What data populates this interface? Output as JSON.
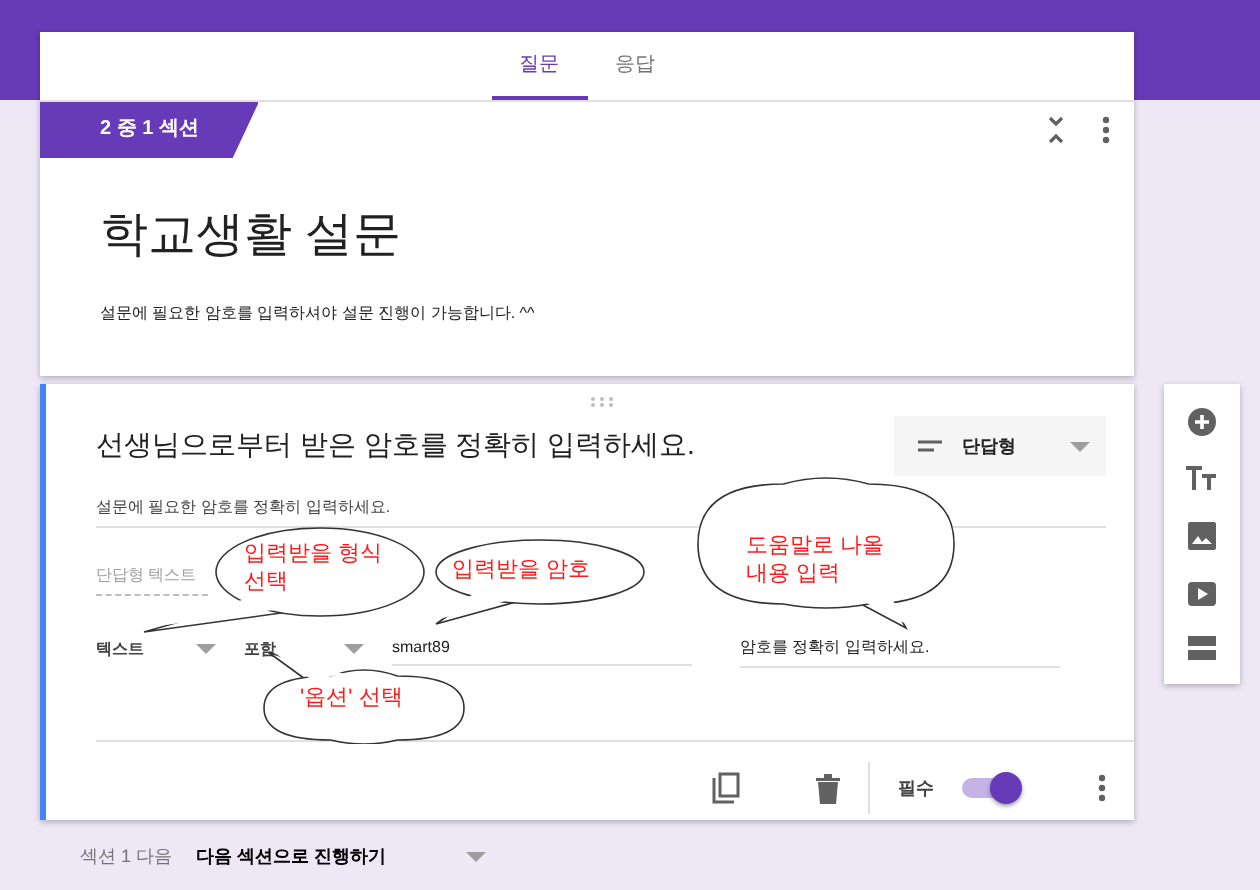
{
  "tabs": [
    {
      "label": "질문",
      "selected": true
    },
    {
      "label": "응답",
      "selected": false
    }
  ],
  "section": {
    "badge": "2 중 1 섹션",
    "title": "학교생활 설문",
    "description": "설문에 필요한 암호를 입력하셔야 설문 진행이 가능합니다. ^^"
  },
  "question": {
    "title": "선생님으로부터 받은 암호를 정확히 입력하세요.",
    "type": "단답형",
    "description": "설문에 필요한 암호를 정확히 입력하세요.",
    "answer_placeholder": "단답형 텍스트",
    "validation": {
      "category": "텍스트",
      "condition": "포함",
      "value": "smart89",
      "error_text": "암호를 정확히 입력하세요."
    },
    "required_label": "필수",
    "required": true
  },
  "callouts": [
    {
      "text": "입력받을 형식 선택",
      "kind": "oval"
    },
    {
      "text": "입력받을 암호",
      "kind": "oval"
    },
    {
      "text": "도움말로 나올 내용 입력",
      "kind": "cloud"
    },
    {
      "text": "'옵션' 선택",
      "kind": "cloud"
    }
  ],
  "footer": {
    "label": "섹션 1 다음",
    "action": "다음 섹션으로 진행하기"
  }
}
